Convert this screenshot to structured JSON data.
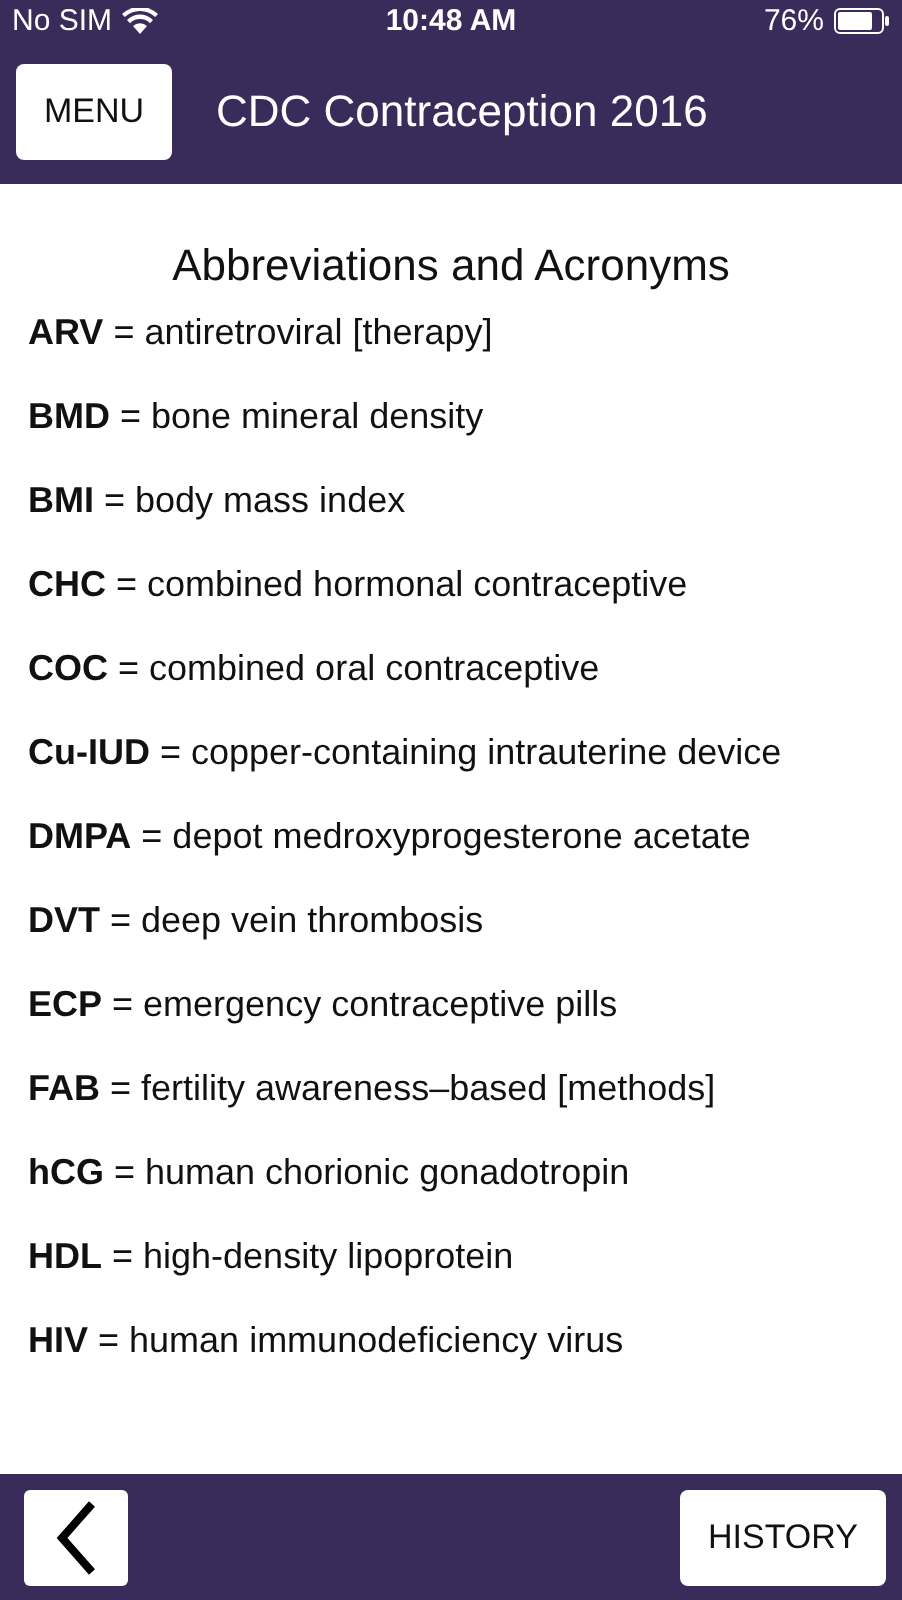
{
  "status_bar": {
    "carrier": "No SIM",
    "time": "10:48 AM",
    "battery": "76%"
  },
  "header": {
    "menu_button": "MENU",
    "title": "CDC Contraception 2016"
  },
  "content": {
    "heading": "Abbreviations and Acronyms",
    "entries": [
      "**ARV** = antiretroviral [therapy]",
      "**BMD** = bone mineral density",
      "**BMI** = body mass index",
      "**CHC** = combined hormonal contraceptive",
      "**COC** = combined oral contraceptive",
      "**Cu-IUD** = copper-containing intrauterine device",
      "**DMPA** = depot medroxyprogesterone acetate",
      "**DVT** = deep vein thrombosis",
      "**ECP** = emergency contraceptive pills",
      "**FAB** = fertility awareness–based [methods]",
      "**hCG** = human chorionic gonadotropin",
      "**HDL** = high-density lipoprotein",
      "**HIV** = human immunodeficiency virus"
    ]
  },
  "footer": {
    "history_button": "HISTORY"
  }
}
